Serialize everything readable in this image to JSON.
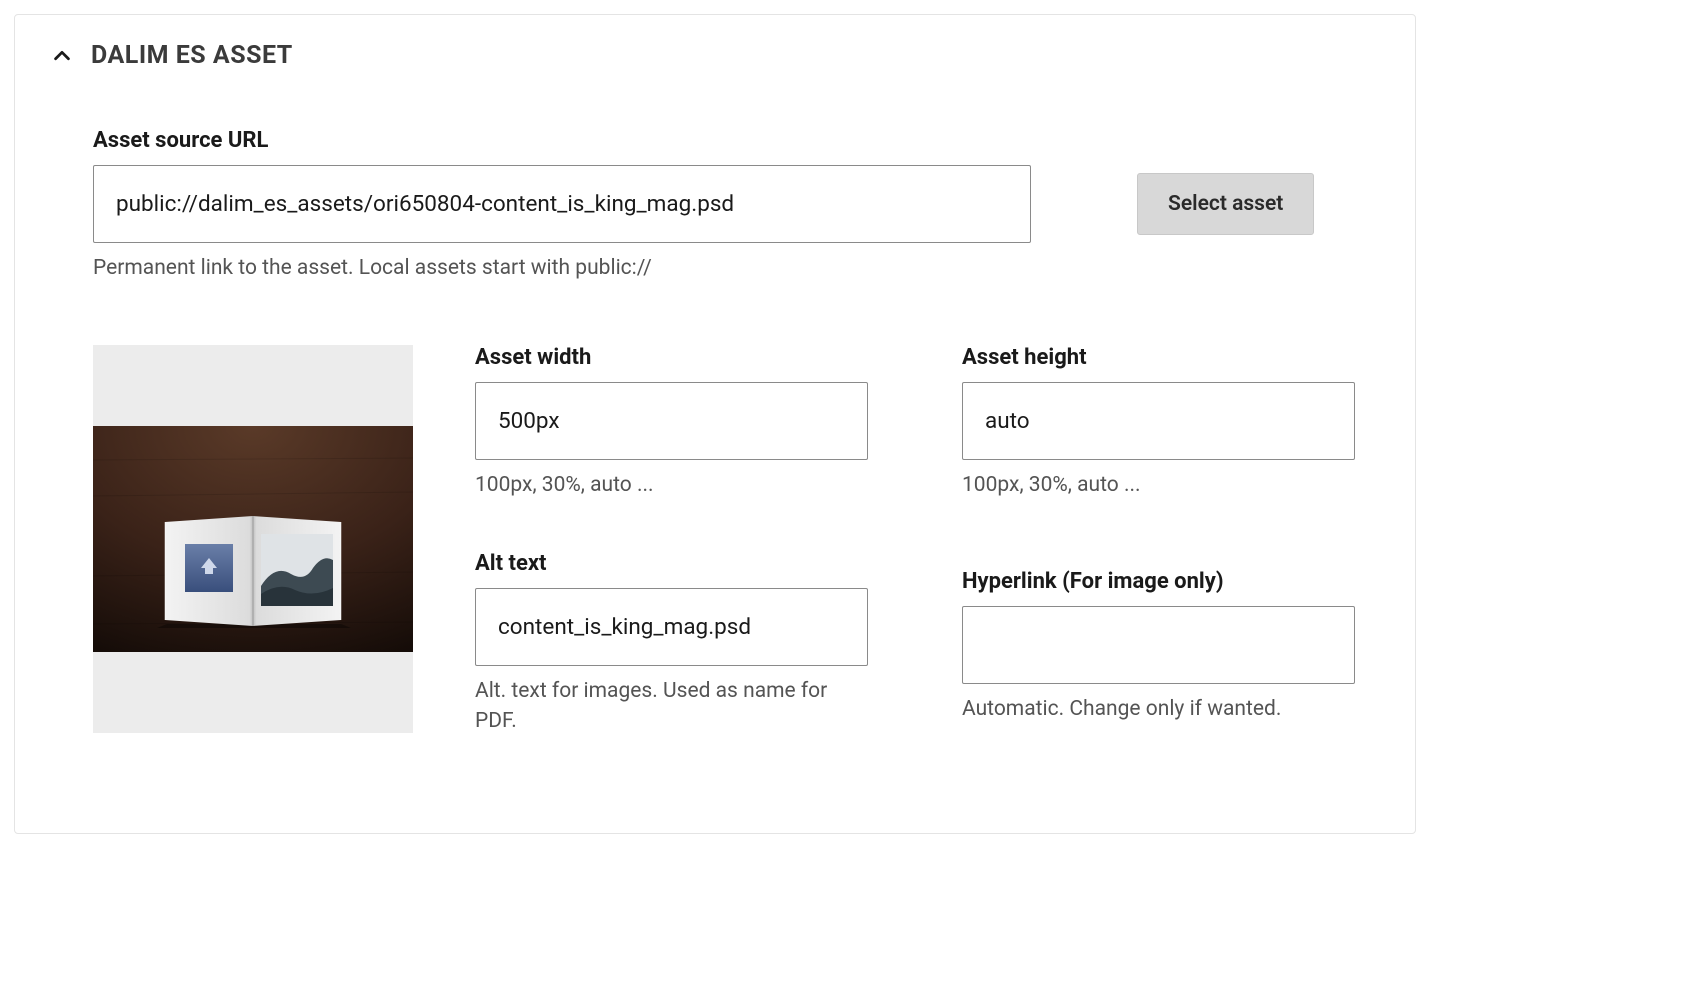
{
  "panel": {
    "title": "DALIM ES ASSET"
  },
  "source": {
    "label": "Asset source URL",
    "value": "public://dalim_es_assets/ori650804-content_is_king_mag.psd",
    "help": "Permanent link to the asset. Local assets start with public://",
    "select_button": "Select asset"
  },
  "width": {
    "label": "Asset width",
    "value": "500px",
    "help": "100px, 30%, auto ..."
  },
  "height": {
    "label": "Asset height",
    "value": "auto",
    "help": "100px, 30%, auto ..."
  },
  "alt": {
    "label": "Alt text",
    "value": "content_is_king_mag.psd",
    "help": "Alt. text for images. Used as name for PDF."
  },
  "hyperlink": {
    "label": "Hyperlink (For image only)",
    "value": "",
    "help": "Automatic. Change only if wanted."
  }
}
